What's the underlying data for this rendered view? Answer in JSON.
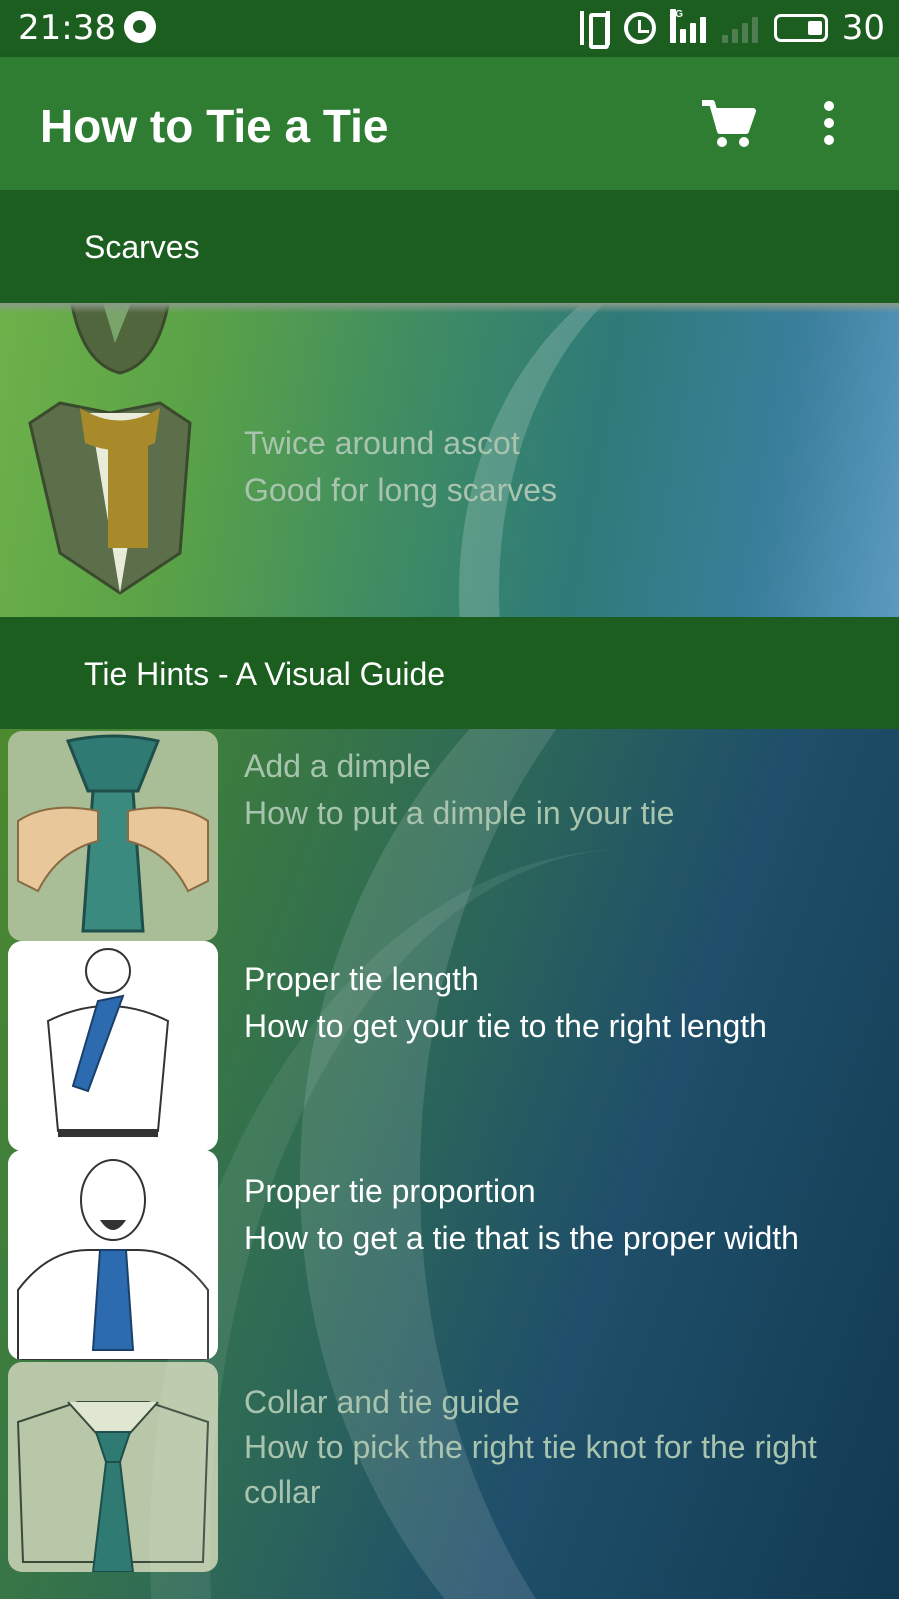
{
  "status_bar": {
    "time": "21:38",
    "network_label": "4G",
    "battery_level": "30"
  },
  "app_bar": {
    "title": "How to Tie a Tie",
    "icons": [
      "cart-icon",
      "overflow-menu-icon"
    ]
  },
  "sections": [
    {
      "header": "Scarves",
      "items": [
        {
          "title": "Twice around ascot",
          "subtitle": "Good for long scarves",
          "style": "dim"
        }
      ]
    },
    {
      "header": "Tie Hints - A Visual Guide",
      "items": [
        {
          "title": "Add a dimple",
          "subtitle": "How to put a dimple in your tie",
          "style": "dim"
        },
        {
          "title": "Proper tie length",
          "subtitle": "How to get your tie to the right length",
          "style": "bright"
        },
        {
          "title": "Proper tie proportion",
          "subtitle": "How to get a tie that is the proper width",
          "style": "bright"
        },
        {
          "title": "Collar and tie guide",
          "subtitle": "How to pick the right tie knot for the right collar",
          "style": "dim"
        }
      ]
    }
  ],
  "colors": {
    "status_bar": "#1b5e20",
    "app_bar": "#2e7d32",
    "section_header": "#1b5e20",
    "dim_text": "#a8c4ae"
  }
}
